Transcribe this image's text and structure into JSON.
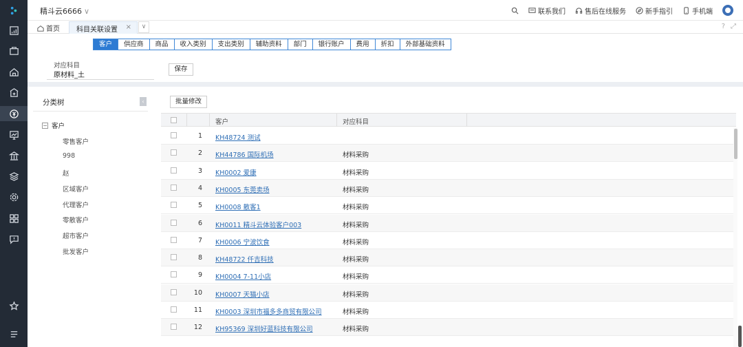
{
  "sidebar": {
    "icons": [
      "logo-icon",
      "calculator-icon",
      "shopping-bag-icon",
      "home-icon",
      "building-icon",
      "yuan-coin-icon",
      "chart-monitor-icon",
      "bank-icon",
      "layers-icon",
      "settings-gear-icon",
      "apps-grid-icon",
      "feedback-icon",
      "star-icon",
      "menu-lines-icon"
    ],
    "active_icon": "yuan-coin-icon"
  },
  "topbar": {
    "company": "精斗云6666",
    "links": [
      "联系我们",
      "售后在线服务",
      "新手指引",
      "手机端"
    ]
  },
  "tabs": {
    "home": "首页",
    "active": "科目关联设置"
  },
  "category_tabs": [
    "客户",
    "供应商",
    "商品",
    "收入类别",
    "支出类别",
    "辅助资料",
    "部门",
    "银行账户",
    "费用",
    "折扣",
    "外部基础资料"
  ],
  "form": {
    "label": "对应科目",
    "value": "原材料_土",
    "save": "保存"
  },
  "tree": {
    "title": "分类树",
    "root": "客户",
    "items": [
      "零售客户",
      "998",
      "赵",
      "区域客户",
      "代理客户",
      "零散客户",
      "超市客户",
      "批发客户"
    ]
  },
  "grid": {
    "batch_button": "批量修改",
    "headers": {
      "customer": "客户",
      "subject": "对应科目"
    },
    "rows": [
      {
        "num": "1",
        "customer": "KH48724 测试",
        "subject": ""
      },
      {
        "num": "2",
        "customer": "KH44786 国际机场",
        "subject": "材料采购"
      },
      {
        "num": "3",
        "customer": "KH0002 爱康",
        "subject": "材料采购"
      },
      {
        "num": "4",
        "customer": "KH0005 东莞卖场",
        "subject": "材料采购"
      },
      {
        "num": "5",
        "customer": "KH0008 散客1",
        "subject": "材料采购"
      },
      {
        "num": "6",
        "customer": "KH0011 精斗云体验客户003",
        "subject": "材料采购"
      },
      {
        "num": "7",
        "customer": "KH0006 宁波饮食",
        "subject": "材料采购"
      },
      {
        "num": "8",
        "customer": "KH48722 仟吉科技",
        "subject": "材料采购"
      },
      {
        "num": "9",
        "customer": "KH0004 7-11小店",
        "subject": "材料采购"
      },
      {
        "num": "10",
        "customer": "KH0007 天猫小店",
        "subject": "材料采购"
      },
      {
        "num": "11",
        "customer": "KH0003 深圳市福多多商贸有限公司",
        "subject": "材料采购"
      },
      {
        "num": "12",
        "customer": "KH95369 深圳好蓝科技有限公司",
        "subject": "材料采购"
      }
    ]
  }
}
